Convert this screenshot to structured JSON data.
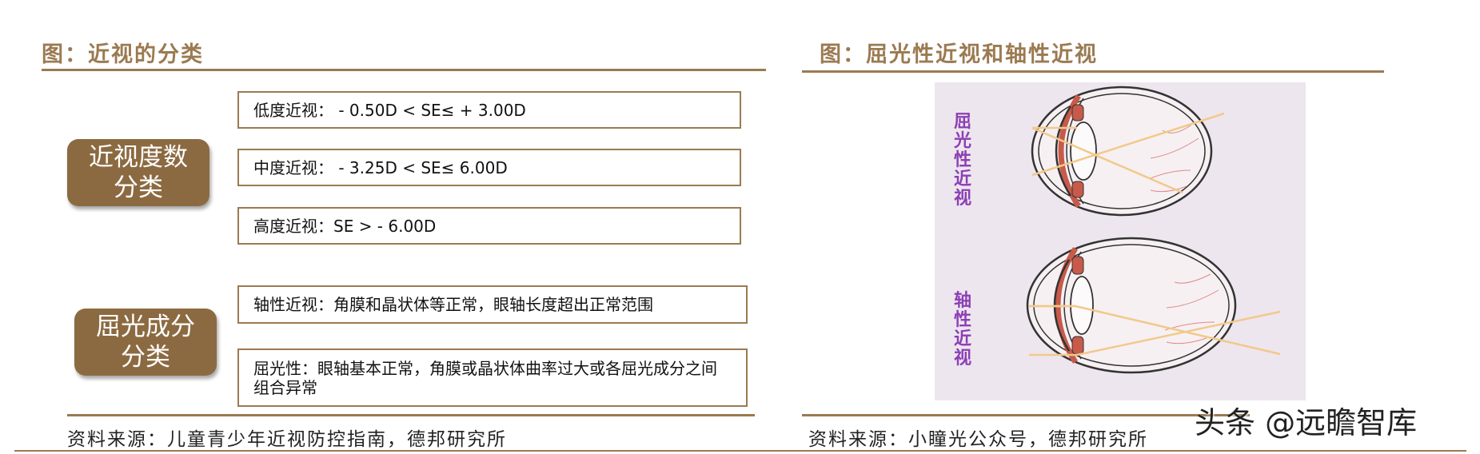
{
  "left_figure": {
    "title": "图：近视的分类",
    "categories": [
      {
        "label_line1": "近视度数",
        "label_line2": "分类"
      },
      {
        "label_line1": "屈光成分",
        "label_line2": "分类"
      }
    ],
    "degree_boxes": [
      "低度近视： - 0.50D < SE≤ + 3.00D",
      "中度近视： - 3.25D < SE≤ 6.00D",
      "高度近视：SE > - 6.00D"
    ],
    "refraction_boxes": [
      "轴性近视：角膜和晶状体等正常，眼轴长度超出正常范围",
      "屈光性：眼轴基本正常，角膜或晶状体曲率过大或各屈光成分之间组合异常"
    ],
    "source": "资料来源：儿童青少年近视防控指南，德邦研究所"
  },
  "right_figure": {
    "title": "图：屈光性近视和轴性近视",
    "label_top": "屈光性近视",
    "label_bottom": "轴性近视",
    "source": "资料来源：小瞳光公众号，德邦研究所"
  },
  "watermark": "头条 @远瞻智库",
  "colors": {
    "accent": "#9b7a52",
    "category_fill": "#8c6a41",
    "label_purple": "#8c3fb5",
    "panel_bg": "#ede6ee",
    "ray": "#f2c98a",
    "lens_red": "#c85a4a"
  }
}
